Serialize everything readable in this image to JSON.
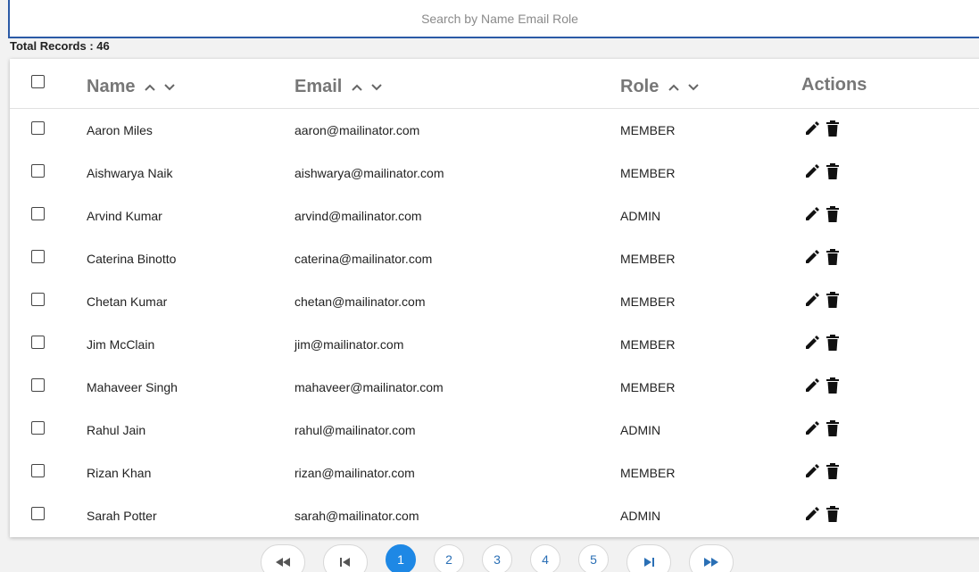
{
  "search": {
    "placeholder": "Search by Name Email Role"
  },
  "total_records": "Total Records : 46",
  "table": {
    "headers": {
      "name": "Name",
      "email": "Email",
      "role": "Role",
      "actions": "Actions"
    },
    "rows": [
      {
        "name": "Aaron Miles",
        "email": "aaron@mailinator.com",
        "role": "MEMBER"
      },
      {
        "name": "Aishwarya Naik",
        "email": "aishwarya@mailinator.com",
        "role": "MEMBER"
      },
      {
        "name": "Arvind Kumar",
        "email": "arvind@mailinator.com",
        "role": "ADMIN"
      },
      {
        "name": "Caterina Binotto",
        "email": "caterina@mailinator.com",
        "role": "MEMBER"
      },
      {
        "name": "Chetan Kumar",
        "email": "chetan@mailinator.com",
        "role": "MEMBER"
      },
      {
        "name": "Jim McClain",
        "email": "jim@mailinator.com",
        "role": "MEMBER"
      },
      {
        "name": "Mahaveer Singh",
        "email": "mahaveer@mailinator.com",
        "role": "MEMBER"
      },
      {
        "name": "Rahul Jain",
        "email": "rahul@mailinator.com",
        "role": "ADMIN"
      },
      {
        "name": "Rizan Khan",
        "email": "rizan@mailinator.com",
        "role": "MEMBER"
      },
      {
        "name": "Sarah Potter",
        "email": "sarah@mailinator.com",
        "role": "ADMIN"
      }
    ]
  },
  "pagination": {
    "pages": [
      "1",
      "2",
      "3",
      "4",
      "5"
    ],
    "current": "1",
    "nav_icons": [
      "first-page-icon",
      "previous-page-icon",
      "next-page-icon",
      "last-page-icon"
    ]
  },
  "colors": {
    "accent": "#1e88e5",
    "search_border": "#2b5aa6"
  }
}
